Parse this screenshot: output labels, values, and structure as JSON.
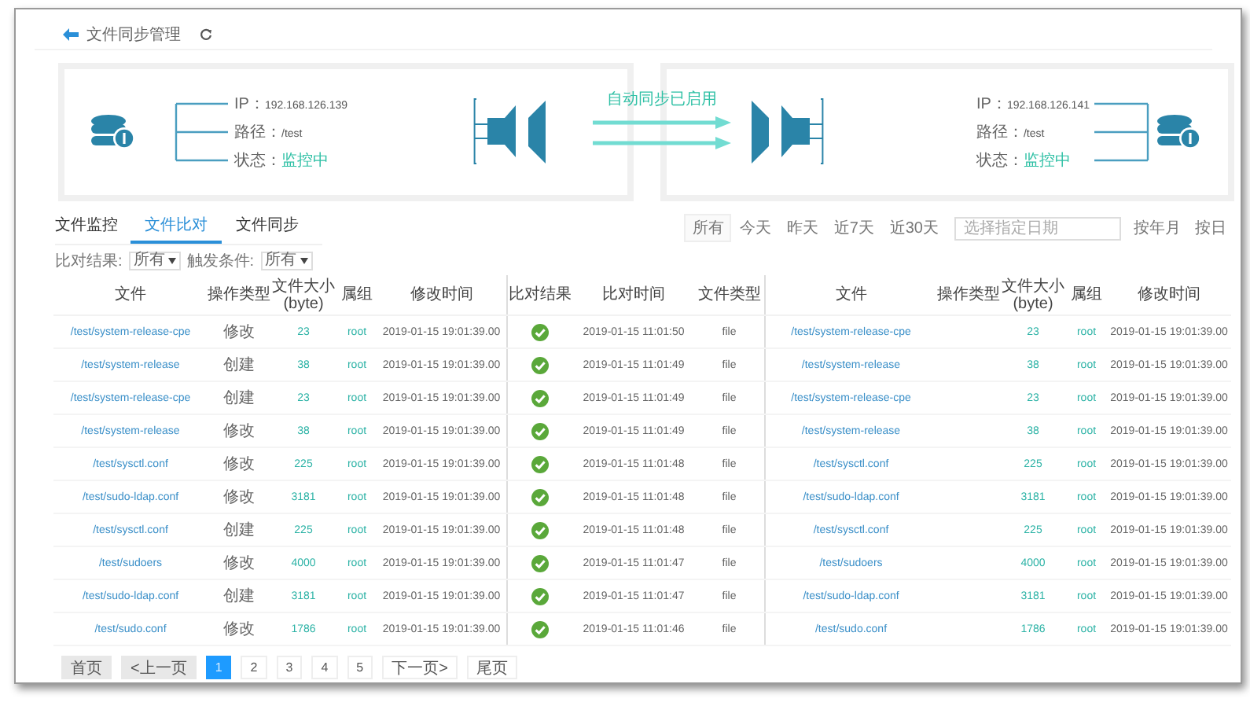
{
  "header": {
    "title": "文件同步管理"
  },
  "servers": [
    {
      "lines": [
        {
          "label": "IP：",
          "value": "192.168.126.139",
          "kind": "text"
        },
        {
          "label": "路径：",
          "value": "/test",
          "kind": "text"
        },
        {
          "label": "状态：",
          "value": "监控中",
          "kind": "status"
        }
      ]
    },
    {
      "lines": [
        {
          "label": "IP：",
          "value": "192.168.126.141",
          "kind": "text"
        },
        {
          "label": "路径：",
          "value": "/test",
          "kind": "text"
        },
        {
          "label": "状态：",
          "value": "监控中",
          "kind": "status"
        }
      ]
    }
  ],
  "sync": {
    "label": "自动同步已启用",
    "enabled": true
  },
  "tabs": [
    {
      "label": "文件监控",
      "selected": false
    },
    {
      "label": "文件比对",
      "selected": true
    },
    {
      "label": "文件同步",
      "selected": false
    }
  ],
  "filters": [
    {
      "label": "比对结果:",
      "value": "所有"
    },
    {
      "label": "触发条件:",
      "value": "所有"
    }
  ],
  "date_range": {
    "options": [
      {
        "label": "所有",
        "selected": true
      },
      {
        "label": "今天",
        "selected": false
      },
      {
        "label": "昨天",
        "selected": false
      },
      {
        "label": "近7天",
        "selected": false
      },
      {
        "label": "近30天",
        "selected": false
      }
    ],
    "date_field": {
      "placeholder": "选择指定日期"
    },
    "modes": [
      "按年月",
      "按日"
    ]
  },
  "table": {
    "source_columns": [
      {
        "label": "文件"
      },
      {
        "label": "操作类型"
      },
      {
        "label": "文件大小",
        "sub": "(byte)"
      },
      {
        "label": "属组"
      },
      {
        "label": "修改时间"
      }
    ],
    "compare_columns": [
      {
        "label": "比对结果"
      },
      {
        "label": "比对时间"
      },
      {
        "label": "文件类型"
      }
    ],
    "target_columns": [
      {
        "label": "文件"
      },
      {
        "label": "操作类型"
      },
      {
        "label": "文件大小",
        "sub": "(byte)"
      },
      {
        "label": "属组"
      },
      {
        "label": "修改时间"
      }
    ],
    "rows": [
      {
        "source": {
          "file": "/test/system-release-cpe",
          "op": "修改",
          "size": "23",
          "group": "root",
          "mtime": "2019-01-15 19:01:39.00"
        },
        "matched": true,
        "compared_at": "2019-01-15 11:01:50",
        "file_type": "file",
        "target": {
          "file": "/test/system-release-cpe",
          "size": "23",
          "group": "root",
          "mtime": "2019-01-15 19:01:39.00"
        }
      },
      {
        "source": {
          "file": "/test/system-release",
          "op": "创建",
          "size": "38",
          "group": "root",
          "mtime": "2019-01-15 19:01:39.00"
        },
        "matched": true,
        "compared_at": "2019-01-15 11:01:49",
        "file_type": "file",
        "target": {
          "file": "/test/system-release",
          "size": "38",
          "group": "root",
          "mtime": "2019-01-15 19:01:39.00"
        }
      },
      {
        "source": {
          "file": "/test/system-release-cpe",
          "op": "创建",
          "size": "23",
          "group": "root",
          "mtime": "2019-01-15 19:01:39.00"
        },
        "matched": true,
        "compared_at": "2019-01-15 11:01:49",
        "file_type": "file",
        "target": {
          "file": "/test/system-release-cpe",
          "size": "23",
          "group": "root",
          "mtime": "2019-01-15 19:01:39.00"
        }
      },
      {
        "source": {
          "file": "/test/system-release",
          "op": "修改",
          "size": "38",
          "group": "root",
          "mtime": "2019-01-15 19:01:39.00"
        },
        "matched": true,
        "compared_at": "2019-01-15 11:01:49",
        "file_type": "file",
        "target": {
          "file": "/test/system-release",
          "size": "38",
          "group": "root",
          "mtime": "2019-01-15 19:01:39.00"
        }
      },
      {
        "source": {
          "file": "/test/sysctl.conf",
          "op": "修改",
          "size": "225",
          "group": "root",
          "mtime": "2019-01-15 19:01:39.00"
        },
        "matched": true,
        "compared_at": "2019-01-15 11:01:48",
        "file_type": "file",
        "target": {
          "file": "/test/sysctl.conf",
          "size": "225",
          "group": "root",
          "mtime": "2019-01-15 19:01:39.00"
        }
      },
      {
        "source": {
          "file": "/test/sudo-ldap.conf",
          "op": "修改",
          "size": "3181",
          "group": "root",
          "mtime": "2019-01-15 19:01:39.00"
        },
        "matched": true,
        "compared_at": "2019-01-15 11:01:48",
        "file_type": "file",
        "target": {
          "file": "/test/sudo-ldap.conf",
          "size": "3181",
          "group": "root",
          "mtime": "2019-01-15 19:01:39.00"
        }
      },
      {
        "source": {
          "file": "/test/sysctl.conf",
          "op": "创建",
          "size": "225",
          "group": "root",
          "mtime": "2019-01-15 19:01:39.00"
        },
        "matched": true,
        "compared_at": "2019-01-15 11:01:48",
        "file_type": "file",
        "target": {
          "file": "/test/sysctl.conf",
          "size": "225",
          "group": "root",
          "mtime": "2019-01-15 19:01:39.00"
        }
      },
      {
        "source": {
          "file": "/test/sudoers",
          "op": "修改",
          "size": "4000",
          "group": "root",
          "mtime": "2019-01-15 19:01:39.00"
        },
        "matched": true,
        "compared_at": "2019-01-15 11:01:47",
        "file_type": "file",
        "target": {
          "file": "/test/sudoers",
          "size": "4000",
          "group": "root",
          "mtime": "2019-01-15 19:01:39.00"
        }
      },
      {
        "source": {
          "file": "/test/sudo-ldap.conf",
          "op": "创建",
          "size": "3181",
          "group": "root",
          "mtime": "2019-01-15 19:01:39.00"
        },
        "matched": true,
        "compared_at": "2019-01-15 11:01:47",
        "file_type": "file",
        "target": {
          "file": "/test/sudo-ldap.conf",
          "size": "3181",
          "group": "root",
          "mtime": "2019-01-15 19:01:39.00"
        }
      },
      {
        "source": {
          "file": "/test/sudo.conf",
          "op": "修改",
          "size": "1786",
          "group": "root",
          "mtime": "2019-01-15 19:01:39.00"
        },
        "matched": true,
        "compared_at": "2019-01-15 11:01:46",
        "file_type": "file",
        "target": {
          "file": "/test/sudo.conf",
          "size": "1786",
          "group": "root",
          "mtime": "2019-01-15 19:01:39.00"
        }
      }
    ]
  },
  "pagination": {
    "first": "首页",
    "prev": "<上一页",
    "pages": [
      {
        "label": "1",
        "selected": true
      },
      {
        "label": "2",
        "selected": false
      },
      {
        "label": "3",
        "selected": false
      },
      {
        "label": "4",
        "selected": false
      },
      {
        "label": "5",
        "selected": false
      }
    ],
    "next": "下一页>",
    "last": "尾页"
  }
}
